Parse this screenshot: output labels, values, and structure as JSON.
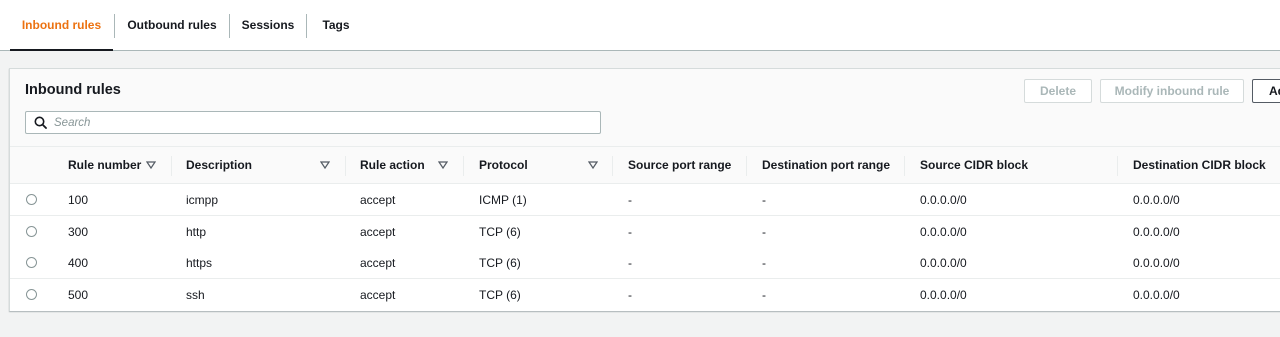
{
  "tabs": [
    "Inbound rules",
    "Outbound rules",
    "Sessions",
    "Tags"
  ],
  "active_tab": "Inbound rules",
  "panel": {
    "title": "Inbound rules",
    "buttons": {
      "delete": "Delete",
      "modify": "Modify inbound rule",
      "add": "Ad"
    },
    "search_placeholder": "Search"
  },
  "table": {
    "columns": [
      "Rule number",
      "Description",
      "Rule action",
      "Protocol",
      "Source port range",
      "Destination port range",
      "Source CIDR block",
      "Destination CIDR block"
    ],
    "rows": [
      [
        "100",
        "icmpp",
        "accept",
        "ICMP (1)",
        "-",
        "-",
        "0.0.0.0/0",
        "0.0.0.0/0"
      ],
      [
        "300",
        "http",
        "accept",
        "TCP (6)",
        "-",
        "-",
        "0.0.0.0/0",
        "0.0.0.0/0"
      ],
      [
        "400",
        "https",
        "accept",
        "TCP (6)",
        "-",
        "-",
        "0.0.0.0/0",
        "0.0.0.0/0"
      ],
      [
        "500",
        "ssh",
        "accept",
        "TCP (6)",
        "-",
        "-",
        "0.0.0.0/0",
        "0.0.0.0/0"
      ]
    ]
  },
  "colors": {
    "accent": "#ec7211",
    "text": "#16191f",
    "disabled_text": "#aab7b8",
    "page_background": "#f2f3f3"
  }
}
